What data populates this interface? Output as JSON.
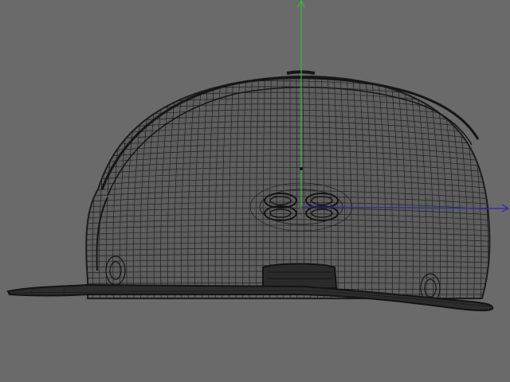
{
  "viewport": {
    "background": "#6a6a6a",
    "wire_color": "#1c1c1c",
    "axis_y_color": "#2fbf3a",
    "axis_x_color": "#2b2ba8"
  },
  "model": {
    "name": "cap-wireframe",
    "kind": "wireframe-mesh"
  },
  "gizmo": {
    "y_axis_icon": "arrow-up-icon",
    "x_axis_icon": "arrow-right-icon"
  }
}
